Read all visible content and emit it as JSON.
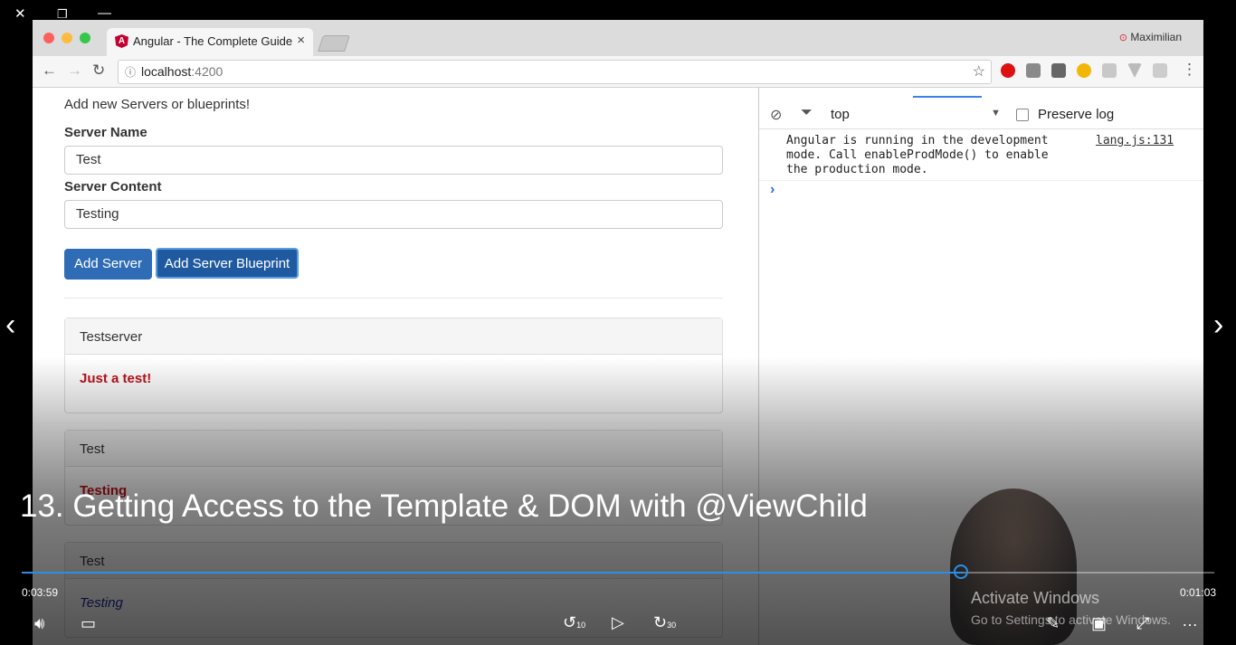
{
  "browser": {
    "tab_title": "Angular - The Complete Guide",
    "tab_close": "×",
    "favicon_letter": "A",
    "profile_name": "Maximilian",
    "url_host": "localhost",
    "url_port": ":4200",
    "colors": {
      "close_dot": "#fc605b",
      "min_dot": "#fdbc40",
      "max_dot": "#34c84a"
    }
  },
  "page": {
    "intro": "Add new Servers or blueprints!",
    "server_name_label": "Server Name",
    "server_name_value": "Test",
    "server_content_label": "Server Content",
    "server_content_value": "Testing",
    "add_server_button": "Add Server",
    "add_blueprint_button": "Add Server Blueprint",
    "panels": [
      {
        "title": "Testserver",
        "content": "Just a test!",
        "color": "#c0111b",
        "style": "bold"
      },
      {
        "title": "Test",
        "content": "Testing",
        "color": "#c0111b",
        "style": "bold"
      },
      {
        "title": "Test",
        "content": "Testing",
        "color": "#1a2a9e",
        "style": "italic"
      }
    ]
  },
  "devtools": {
    "context": "top",
    "preserve_log": "Preserve log",
    "message": "Angular is running in the development mode. Call enableProdMode() to enable the production mode.",
    "message_source": "lang.js:131",
    "prompt": "›"
  },
  "player": {
    "title": "13. Getting Access to the Template & DOM with @ViewChild",
    "elapsed": "0:03:59",
    "remaining": "0:01:03",
    "progress": 0.79,
    "watermark_title": "Activate Windows",
    "watermark_sub": "Go to Settings to activate Windows.",
    "skip_back": "10",
    "skip_forward": "30",
    "accent": "#2b8fe6"
  }
}
